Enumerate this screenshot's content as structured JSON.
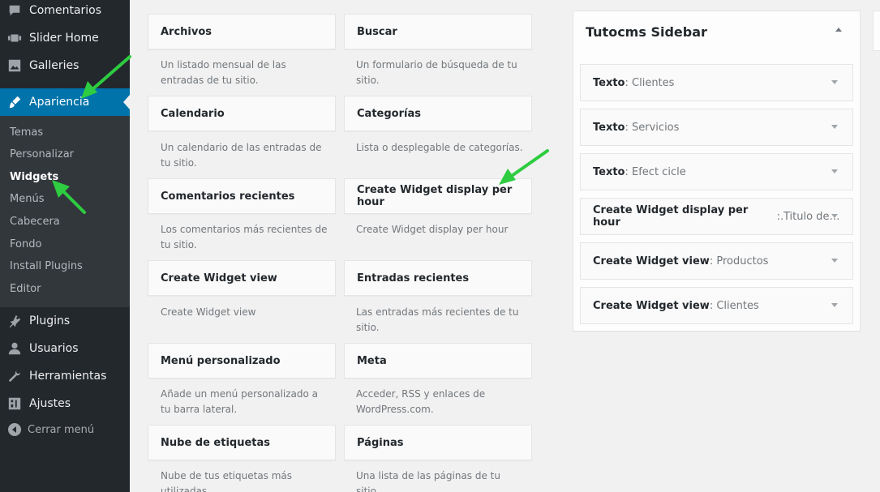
{
  "menu": {
    "items": [
      {
        "label": "Comentarios",
        "icon": "comment-icon"
      },
      {
        "label": "Slider Home",
        "icon": "slider-icon"
      },
      {
        "label": "Galleries",
        "icon": "gallery-icon"
      },
      {
        "label": "Apariencia",
        "icon": "brush-icon"
      }
    ],
    "submenu": [
      "Temas",
      "Personalizar",
      "Widgets",
      "Menús",
      "Cabecera",
      "Fondo",
      "Install Plugins",
      "Editor"
    ],
    "lower_items": [
      {
        "label": "Plugins",
        "icon": "plugin-icon"
      },
      {
        "label": "Usuarios",
        "icon": "users-icon"
      },
      {
        "label": "Herramientas",
        "icon": "wrench-icon"
      },
      {
        "label": "Ajustes",
        "icon": "settings-icon"
      }
    ],
    "collapse_label": "Cerrar menú"
  },
  "widgets": [
    {
      "title": "Archivos",
      "desc": "Un listado mensual de las entradas de tu sitio."
    },
    {
      "title": "Buscar",
      "desc": "Un formulario de búsqueda de tu sitio."
    },
    {
      "title": "Calendario",
      "desc": "Un calendario de las entradas de tu sitio."
    },
    {
      "title": "Categorías",
      "desc": "Lista o desplegable de categorías."
    },
    {
      "title": "Comentarios recientes",
      "desc": "Los comentarios más recientes de tu sitio."
    },
    {
      "title": "Create Widget display per hour",
      "desc": "Create Widget display per hour"
    },
    {
      "title": "Create Widget view",
      "desc": "Create Widget view"
    },
    {
      "title": "Entradas recientes",
      "desc": "Las entradas más recientes de tu sitio."
    },
    {
      "title": "Menú personalizado",
      "desc": "Añade un menú personalizado a tu barra lateral."
    },
    {
      "title": "Meta",
      "desc": "Acceder, RSS y enlaces de WordPress.com."
    },
    {
      "title": "Nube de etiquetas",
      "desc": "Nube de tus etiquetas más utilizadas."
    },
    {
      "title": "Páginas",
      "desc": "Una lista de las páginas de tu sitio."
    }
  ],
  "sidebar_panel": {
    "title": "Tutocms Sidebar",
    "widgets": [
      {
        "title": "Texto",
        "sub": "Clientes"
      },
      {
        "title": "Texto",
        "sub": "Servicios"
      },
      {
        "title": "Texto",
        "sub": "Efect cicle"
      },
      {
        "title": "Create Widget display per hour",
        "sub": "Titulo de la sección"
      },
      {
        "title": "Create Widget view",
        "sub": "Productos"
      },
      {
        "title": "Create Widget view",
        "sub": "Clientes"
      }
    ]
  },
  "colors": {
    "menu_bg": "#23282d",
    "submenu_bg": "#32373c",
    "accent": "#0073aa",
    "arrow": "#2ecc40"
  }
}
